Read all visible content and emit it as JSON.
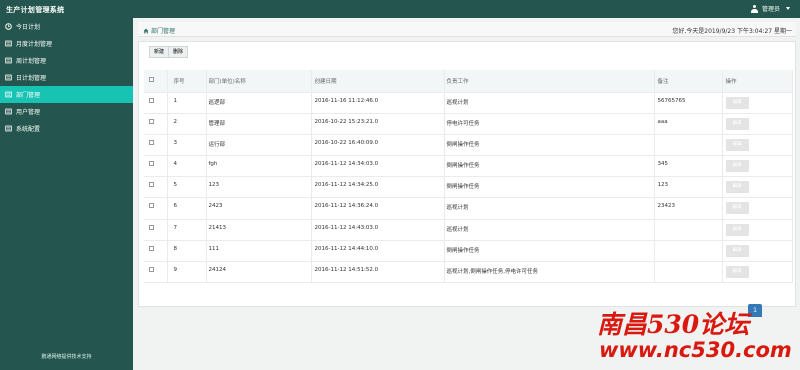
{
  "app": {
    "title": "生产计划管理系统"
  },
  "user": {
    "name": "管理员"
  },
  "sidebar": {
    "items": [
      {
        "label": "今日计划",
        "icon": "clock-icon",
        "active": false
      },
      {
        "label": "月度计划管理",
        "icon": "list-icon",
        "active": false
      },
      {
        "label": "周计划管理",
        "icon": "list-icon",
        "active": false
      },
      {
        "label": "日计划管理",
        "icon": "list-icon",
        "active": false
      },
      {
        "label": "部门管理",
        "icon": "list-icon",
        "active": true
      },
      {
        "label": "用户管理",
        "icon": "list-icon",
        "active": false
      },
      {
        "label": "系统配置",
        "icon": "list-icon",
        "active": false
      }
    ],
    "footer": "鹏通网络提供技术支持"
  },
  "breadcrumb": {
    "text": "部门管理"
  },
  "datetime": "您好,今天是2019/9/23 下午3:04:27 星期一",
  "toolbar": {
    "new_label": "新建",
    "delete_label": "删除"
  },
  "table": {
    "headers": [
      "序号",
      "部门(单位)名称",
      "创建日期",
      "负责工作",
      "备注",
      "操作"
    ],
    "action_label": "编辑",
    "rows": [
      {
        "seq": "1",
        "name": "巡逻部",
        "date": "2016-11-16 11:12:46.0",
        "duty": "巡视计划",
        "note": "56765765"
      },
      {
        "seq": "2",
        "name": "管理部",
        "date": "2016-10-22 15:23:21.0",
        "duty": "停电许可任务",
        "note": "aaa"
      },
      {
        "seq": "3",
        "name": "运行部",
        "date": "2016-10-22 16:40:09.0",
        "duty": "倒闸操作任务",
        "note": ""
      },
      {
        "seq": "4",
        "name": "fgh",
        "date": "2016-11-12 14:34:03.0",
        "duty": "倒闸操作任务",
        "note": "345"
      },
      {
        "seq": "5",
        "name": "123",
        "date": "2016-11-12 14:34:25.0",
        "duty": "倒闸操作任务",
        "note": "123"
      },
      {
        "seq": "6",
        "name": "2423",
        "date": "2016-11-12 14:36:24.0",
        "duty": "巡视计划",
        "note": "23423"
      },
      {
        "seq": "7",
        "name": "21413",
        "date": "2016-11-12 14:43:03.0",
        "duty": "巡视计划",
        "note": ""
      },
      {
        "seq": "8",
        "name": "111",
        "date": "2016-11-12 14:44:10.0",
        "duty": "倒闸操作任务",
        "note": ""
      },
      {
        "seq": "9",
        "name": "24124",
        "date": "2016-11-12 14:51:52.0",
        "duty": "巡视计划,倒闸操作任务,停电许可任务",
        "note": ""
      }
    ]
  },
  "pagination": {
    "current": "1"
  },
  "watermark": {
    "line1": "南昌530论坛",
    "line2": "www.nc530.com"
  },
  "colors": {
    "sidebar": "#24564f",
    "active": "#17c3b3",
    "brand_red": "#d9180f"
  }
}
